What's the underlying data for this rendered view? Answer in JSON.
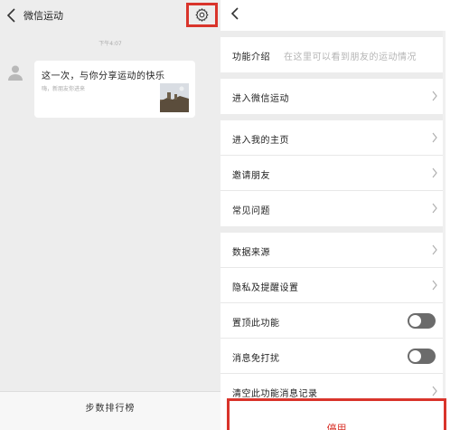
{
  "chat": {
    "title": "微信运动",
    "time": "下午4:07",
    "card": {
      "title": "这一次，与你分享运动的快乐",
      "subtitle": "嗨，新朋友你进来"
    },
    "footer_label": "步数排行榜"
  },
  "settings": {
    "intro": {
      "label": "功能介绍",
      "desc": "在这里可以看到朋友的运动情况"
    },
    "enter_sport": {
      "label": "进入微信运动"
    },
    "my_homepage": {
      "label": "进入我的主页"
    },
    "invite_friends": {
      "label": "邀请朋友"
    },
    "faq": {
      "label": "常见问题"
    },
    "data_source": {
      "label": "数据来源"
    },
    "privacy_reminder": {
      "label": "隐私及提醒设置"
    },
    "pin_feature": {
      "label": "置顶此功能",
      "enabled": false
    },
    "mute_notifications": {
      "label": "消息免打扰",
      "enabled": false
    },
    "clear_history": {
      "label": "清空此功能消息记录"
    },
    "exit_label": "停用"
  },
  "colors": {
    "highlight": "#d9342b",
    "toggle_off": "#6b6b6b",
    "background": "#ededed"
  },
  "icons": [
    "back-arrow-icon",
    "gear-icon",
    "avatar-icon",
    "chevron-right-icon"
  ]
}
